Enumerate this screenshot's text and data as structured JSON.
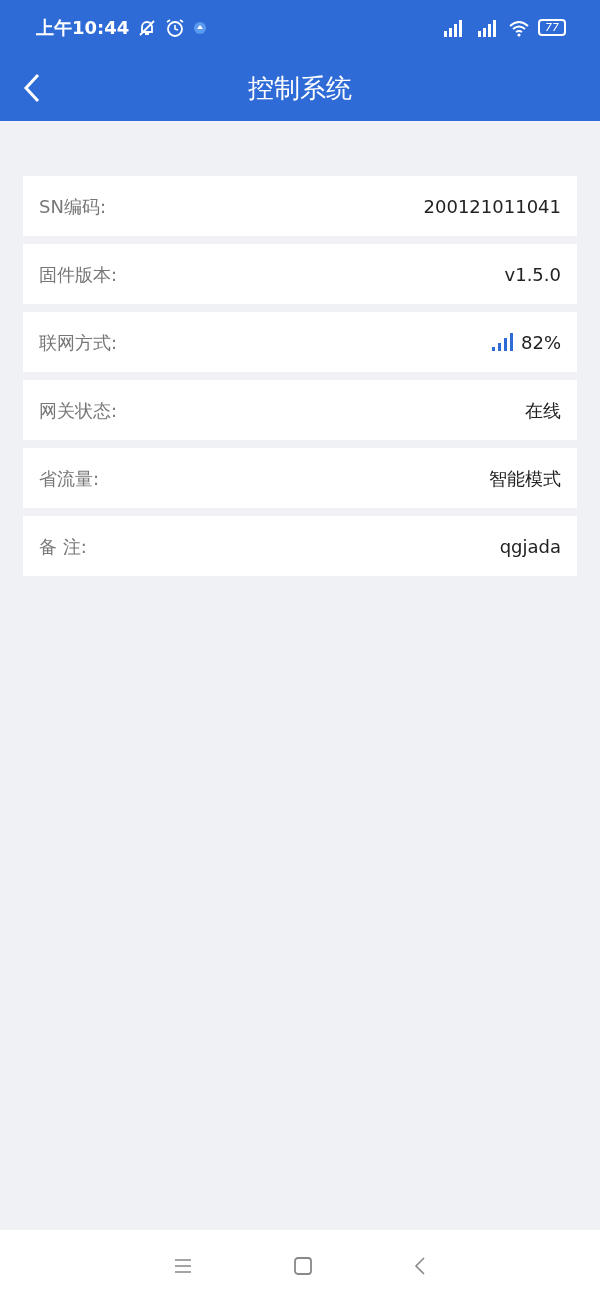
{
  "status_bar": {
    "time": "上午10:44",
    "battery": "77"
  },
  "header": {
    "title": "控制系统"
  },
  "rows": [
    {
      "label": "SN编码:",
      "value": "200121011041",
      "kind": "text"
    },
    {
      "label": "固件版本:",
      "value": "v1.5.0",
      "kind": "text"
    },
    {
      "label": "联网方式:",
      "value": "82%",
      "kind": "signal"
    },
    {
      "label": "网关状态:",
      "value": "在线",
      "kind": "text"
    },
    {
      "label": "省流量:",
      "value": "智能模式",
      "kind": "text"
    },
    {
      "label": "备 注:",
      "value": "qgjada",
      "kind": "text"
    }
  ]
}
